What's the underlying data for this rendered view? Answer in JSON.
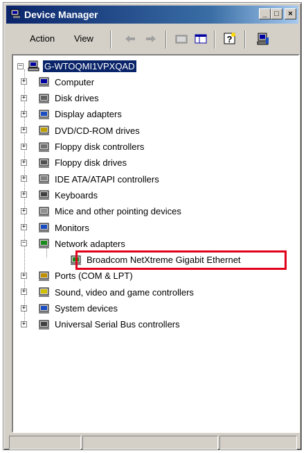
{
  "window": {
    "title": "Device Manager"
  },
  "title_buttons": [
    "_",
    "□",
    "×"
  ],
  "menu": {
    "action": "Action",
    "view": "View"
  },
  "tree": {
    "root": "G-WTOQMI1VPXQAD",
    "items": [
      {
        "label": "Computer",
        "icon": "computer-icon"
      },
      {
        "label": "Disk drives",
        "icon": "disk-drive-icon"
      },
      {
        "label": "Display adapters",
        "icon": "display-adapter-icon"
      },
      {
        "label": "DVD/CD-ROM drives",
        "icon": "cdrom-icon"
      },
      {
        "label": "Floppy disk controllers",
        "icon": "floppy-controller-icon"
      },
      {
        "label": "Floppy disk drives",
        "icon": "floppy-drive-icon"
      },
      {
        "label": "IDE ATA/ATAPI controllers",
        "icon": "ide-controller-icon"
      },
      {
        "label": "Keyboards",
        "icon": "keyboard-icon"
      },
      {
        "label": "Mice and other pointing devices",
        "icon": "mouse-icon"
      },
      {
        "label": "Monitors",
        "icon": "monitor-icon"
      },
      {
        "label": "Network adapters",
        "icon": "network-adapter-icon",
        "expanded": true
      },
      {
        "label": "Broadcom NetXtreme Gigabit Ethernet",
        "icon": "network-card-icon",
        "child": true
      },
      {
        "label": "Ports (COM & LPT)",
        "icon": "port-icon"
      },
      {
        "label": "Sound, video and game controllers",
        "icon": "sound-icon"
      },
      {
        "label": "System devices",
        "icon": "system-device-icon"
      },
      {
        "label": "Universal Serial Bus controllers",
        "icon": "usb-icon"
      }
    ]
  },
  "expander": {
    "collapsed": "+",
    "expanded": "−"
  }
}
